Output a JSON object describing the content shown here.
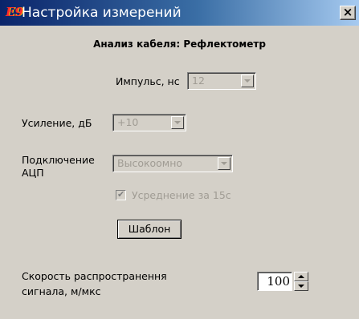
{
  "window": {
    "title": "Настройка измерений",
    "icon_text": "E9",
    "close_label": "×"
  },
  "subtitle": "Анализ кабеля: Рефлектометр",
  "pulse": {
    "label": "Импульс, нс",
    "value": "12",
    "enabled": false
  },
  "gain": {
    "label": "Усиление, дБ",
    "value": "+10",
    "enabled": false
  },
  "adc": {
    "label_line1": "Подключение",
    "label_line2": "АЦП",
    "value": "Высокоомно",
    "enabled": false
  },
  "averaging": {
    "label": "Усреднение за 15с",
    "checked": true,
    "enabled": false
  },
  "template_button": {
    "label": "Шаблон"
  },
  "speed": {
    "label_line1": "Скорость распространення",
    "label_line2": "сигнала, м/мкс",
    "value": "100"
  },
  "icons": {
    "app": "app-logo-icon",
    "close": "close-icon",
    "dropdown": "chevron-down-icon",
    "check": "check-icon",
    "spin_up": "arrow-up-icon",
    "spin_down": "arrow-down-icon"
  },
  "colors": {
    "window_bg": "#d4d0c8",
    "titlebar_start": "#0a246a",
    "titlebar_end": "#a6caf0",
    "title_text": "#ffffff",
    "disabled_text": "#a09c94"
  }
}
